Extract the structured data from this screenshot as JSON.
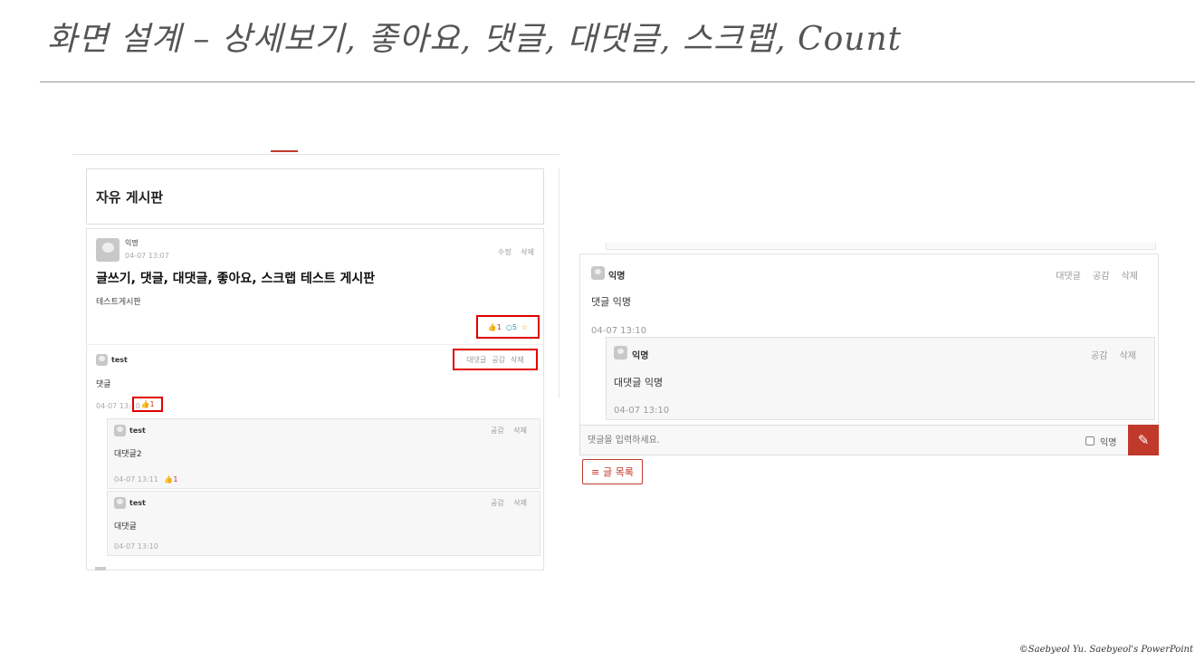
{
  "slide": {
    "title": "화면 설계 – 상세보기, 좋아요, 댓글, 대댓글, 스크랩, Count",
    "copyright": "©Saebyeol Yu. Saebyeol's PowerPoint"
  },
  "board": {
    "title": "자유 게시판"
  },
  "post": {
    "author": "익명",
    "date": "04-07 13:07",
    "edit_label": "수정",
    "delete_label": "삭제",
    "title": "글쓰기, 댓글, 대댓글, 좋아요, 스크랩 테스트 게시판",
    "body": "테스트게시판",
    "like_count": "1",
    "comment_count": "5",
    "scrap_count": ""
  },
  "comment": {
    "author": "test",
    "text": "댓글",
    "date": "04-07 13:10",
    "like_count": "1",
    "reply_label": "대댓글",
    "like_label": "공감",
    "delete_label": "삭제"
  },
  "replies": [
    {
      "author": "test",
      "text": "대댓글2",
      "date": "04-07 13:11",
      "like_count": "1",
      "like_label": "공감",
      "delete_label": "삭제"
    },
    {
      "author": "test",
      "text": "대댓글",
      "date": "04-07 13:10",
      "like_label": "공감",
      "delete_label": "삭제"
    }
  ],
  "right_panel": {
    "comment": {
      "author": "익명",
      "text": "댓글 익명",
      "date": "04-07 13:10",
      "reply_label": "대댓글",
      "like_label": "공감",
      "delete_label": "삭제"
    },
    "reply": {
      "author": "익명",
      "text": "대댓글 익명",
      "date": "04-07 13:10",
      "like_label": "공감",
      "delete_label": "삭제"
    },
    "input": {
      "placeholder": "댓글을 입력하세요.",
      "anonymous_label": "익명"
    },
    "list_button": "글 목록"
  },
  "colors": {
    "accent": "#c0392b",
    "annotation": "#e00000",
    "comment_icon": "#1a9a9a",
    "star": "#e5a50a"
  },
  "icons": [
    "avatar-icon",
    "thumbs-up-icon",
    "comment-icon",
    "star-icon",
    "pencil-icon",
    "list-icon"
  ]
}
